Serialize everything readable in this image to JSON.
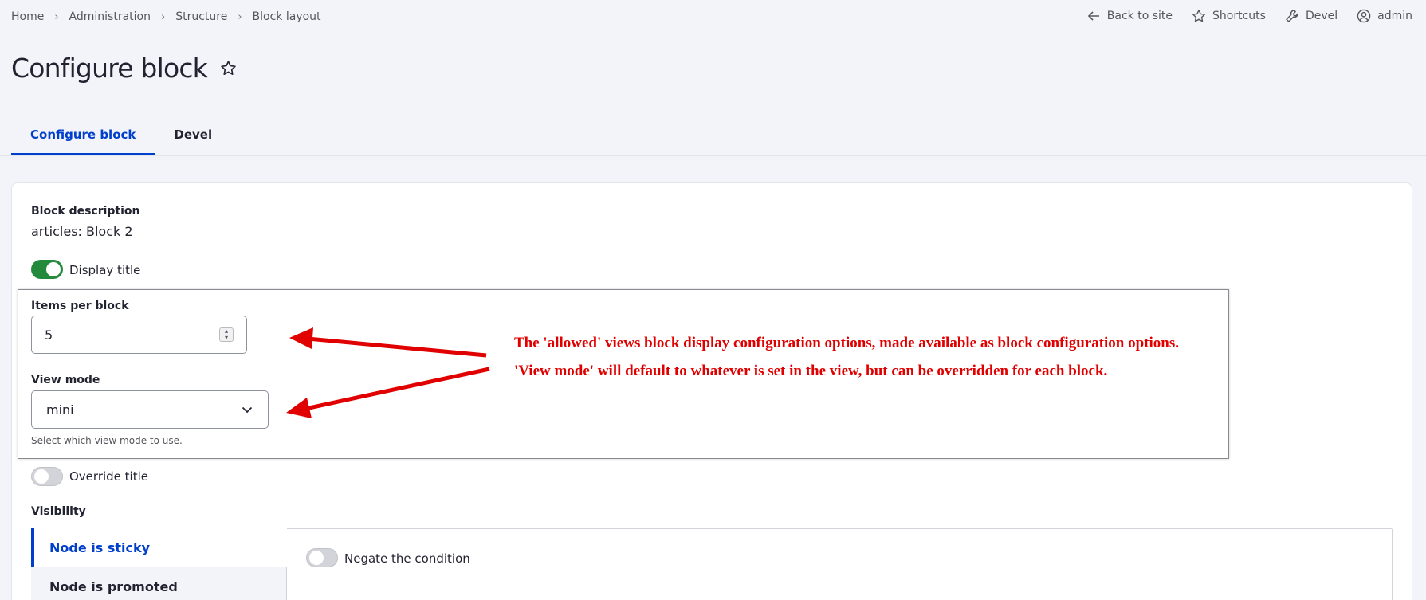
{
  "breadcrumb": [
    "Home",
    "Administration",
    "Structure",
    "Block layout"
  ],
  "toolbar": {
    "back": "Back to site",
    "shortcuts": "Shortcuts",
    "devel": "Devel",
    "user": "admin"
  },
  "page": {
    "title": "Configure block"
  },
  "tabs": [
    {
      "label": "Configure block",
      "active": true
    },
    {
      "label": "Devel",
      "active": false
    }
  ],
  "form": {
    "block_description_label": "Block description",
    "block_description_value": "articles: Block 2",
    "display_title_label": "Display title",
    "display_title_on": true,
    "items_per_block_label": "Items per block",
    "items_per_block_value": "5",
    "view_mode_label": "View mode",
    "view_mode_value": "mini",
    "view_mode_help": "Select which view mode to use.",
    "override_title_label": "Override title",
    "override_title_on": false,
    "visibility_label": "Visibility",
    "visibility_tabs": [
      "Node is sticky",
      "Node is promoted"
    ],
    "negate_label": "Negate the condition"
  },
  "annotation": {
    "line1": "The 'allowed' views block display configuration options, made available as block configuration options.",
    "line2": "'View mode' will default to whatever is set in the view, but can be overridden for each block.",
    "color": "#e00000"
  },
  "colors": {
    "accent": "#003ecc",
    "toggle_on": "#228a3a"
  }
}
